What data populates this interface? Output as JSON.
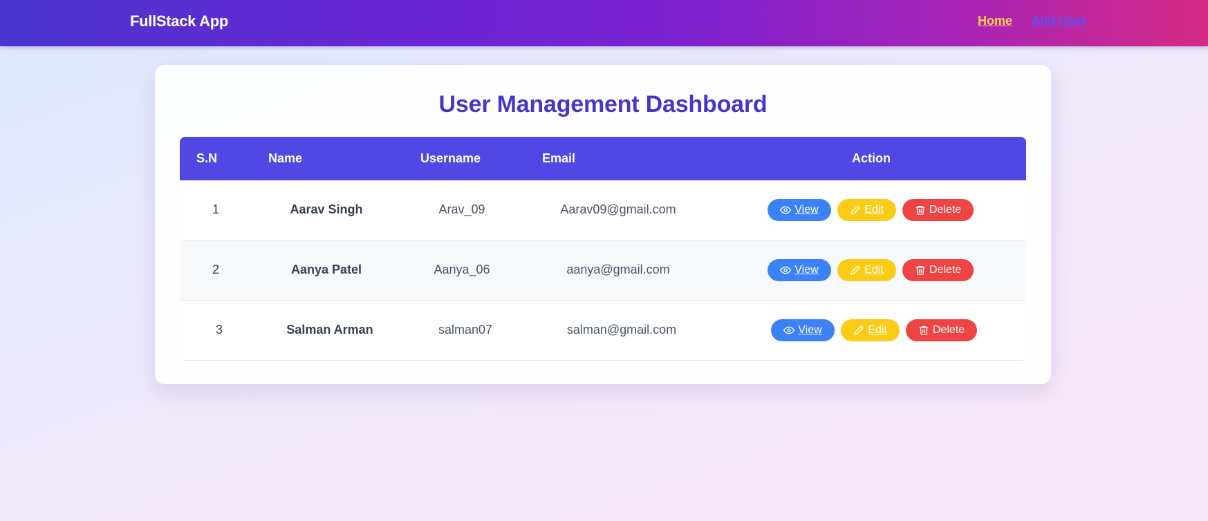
{
  "navbar": {
    "brand": "FullStack App",
    "links": [
      {
        "label": "Home",
        "active": true
      },
      {
        "label": "Add User",
        "active": false
      }
    ]
  },
  "dashboard": {
    "title": "User Management Dashboard",
    "columns": [
      "S.N",
      "Name",
      "Username",
      "Email",
      "Action"
    ],
    "actions": {
      "view": "View",
      "edit": "Edit",
      "delete": "Delete"
    },
    "rows": [
      {
        "sn": "1",
        "name": "Aarav Singh",
        "username": "Arav_09",
        "email": "Aarav09@gmail.com"
      },
      {
        "sn": "2",
        "name": "Aanya Patel",
        "username": "Aanya_06",
        "email": "aanya@gmail.com"
      },
      {
        "sn": "3",
        "name": "Salman Arman",
        "username": "salman07",
        "email": "salman@gmail.com"
      }
    ]
  },
  "colors": {
    "title": "#4338ca",
    "table_header": "#5048e5",
    "view_button": "#3b82f6",
    "edit_button": "#facc15",
    "delete_button": "#ef4444",
    "nav_active": "#fcd34d"
  },
  "icons": {
    "view": "eye-icon",
    "edit": "pencil-icon",
    "delete": "trash-icon"
  }
}
